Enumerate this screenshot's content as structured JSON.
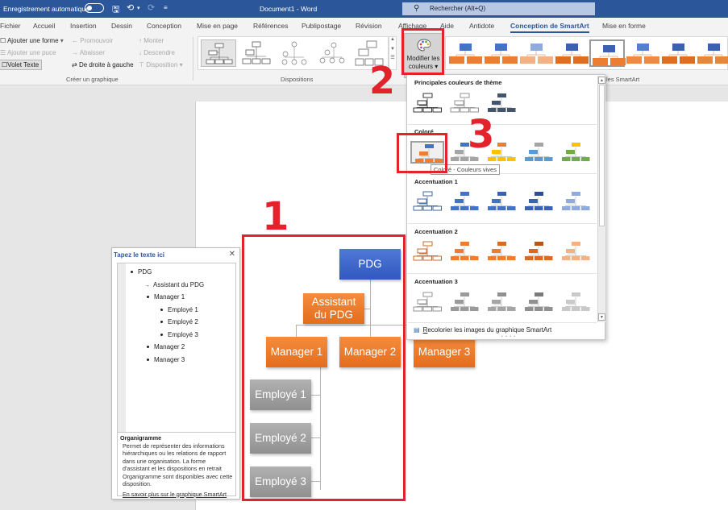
{
  "titlebar": {
    "autosave_label": "Enregistrement automatique",
    "autosave_state": "off",
    "doc_title": "Document1 - Word",
    "search_placeholder": "Rechercher (Alt+Q)",
    "icons": [
      "save-icon",
      "undo-icon",
      "redo-icon",
      "customize-toolbar-icon"
    ]
  },
  "tabs": [
    {
      "label": "Fichier"
    },
    {
      "label": "Accueil"
    },
    {
      "label": "Insertion"
    },
    {
      "label": "Dessin"
    },
    {
      "label": "Conception"
    },
    {
      "label": "Mise en page"
    },
    {
      "label": "Références"
    },
    {
      "label": "Publipostage"
    },
    {
      "label": "Révision"
    },
    {
      "label": "Affichage"
    },
    {
      "label": "Aide"
    },
    {
      "label": "Antidote"
    },
    {
      "label": "Conception de SmartArt",
      "active": true
    },
    {
      "label": "Mise en forme"
    }
  ],
  "ribbon": {
    "create_graphic": {
      "add_shape": "Ajouter une forme",
      "add_bullet": "Ajouter une puce",
      "text_pane": "Volet Texte",
      "promote": "Promouvoir",
      "demote": "Abaisser",
      "right_to_left": "De droite à gauche",
      "move_up": "Monter",
      "move_down": "Descendre",
      "layout": "Disposition",
      "group_label": "Créer un graphique"
    },
    "layouts": {
      "group_label": "Dispositions"
    },
    "change_colors": {
      "line1": "Modifier les",
      "line2": "couleurs"
    },
    "styles": {
      "group_label_fragment": "les SmartArt"
    }
  },
  "text_pane": {
    "title": "Tapez le texte ici",
    "items": [
      {
        "text": "PDG",
        "level": 1,
        "type": "bullet"
      },
      {
        "text": "Assistant du PDG",
        "level": 2,
        "type": "assistant"
      },
      {
        "text": "Manager 1",
        "level": 2,
        "type": "bullet"
      },
      {
        "text": "Employé 1",
        "level": 3,
        "type": "bullet"
      },
      {
        "text": "Employé 2",
        "level": 3,
        "type": "bullet"
      },
      {
        "text": "Employé 3",
        "level": 3,
        "type": "bullet"
      },
      {
        "text": "Manager 2",
        "level": 2,
        "type": "bullet"
      },
      {
        "text": "Manager 3",
        "level": 2,
        "type": "bullet"
      }
    ],
    "desc_title": "Organigramme",
    "desc_text": "Permet de représenter des informations hiérarchiques ou les relations de rapport dans une organisation. La forme d'assistant et les dispositions en retrait Organigramme sont disponibles avec cette disposition.",
    "learn_more": "En savoir plus sur le graphique SmartArt"
  },
  "org_chart": {
    "pdg": "PDG",
    "assistant_line1": "Assistant",
    "assistant_line2": "du PDG",
    "managers": [
      "Manager 1",
      "Manager 2",
      "Manager 3"
    ],
    "employees": [
      "Employé 1",
      "Employé 2",
      "Employé 3"
    ]
  },
  "annotations": {
    "one": "1",
    "two": "2",
    "three": "3"
  },
  "color_dropdown": {
    "sections": [
      {
        "title": "Principales couleurs de thème",
        "count": 3
      },
      {
        "title": "Coloré",
        "count": 5
      },
      {
        "title": "Accentuation 1",
        "count": 5
      },
      {
        "title": "Accentuation 2",
        "count": 5
      },
      {
        "title": "Accentuation 3",
        "count": 5
      }
    ],
    "tooltip": "Coloré - Couleurs vives",
    "recolor_label_first": "R",
    "recolor_label_rest": "ecolorier les images du graphique SmartArt"
  },
  "colors": {
    "accent_blue": "#4472c4",
    "accent_orange": "#ed7d31",
    "gray": "#a5a5a5",
    "yellow": "#ffc000",
    "lightblue": "#5b9bd5",
    "green": "#70ad47",
    "annotation_red": "#e3222b",
    "word_blue": "#2b579a"
  }
}
